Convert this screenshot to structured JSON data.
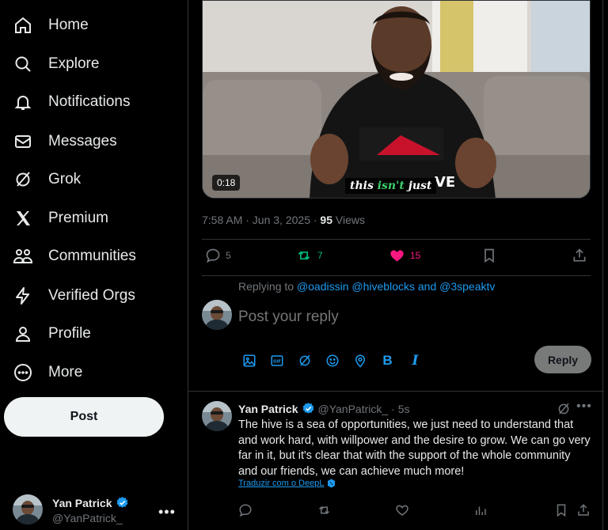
{
  "nav": {
    "home": "Home",
    "explore": "Explore",
    "notifications": "Notifications",
    "messages": "Messages",
    "grok": "Grok",
    "premium": "Premium",
    "communities": "Communities",
    "verified_orgs": "Verified Orgs",
    "profile": "Profile",
    "more": "More",
    "post_button": "Post"
  },
  "account": {
    "name": "Yan Patrick",
    "handle": "@YanPatrick_"
  },
  "video": {
    "duration": "0:18",
    "subtitle_a": "this",
    "subtitle_b": "isn't",
    "subtitle_c": "just",
    "shirt_text": "VE"
  },
  "post_meta": {
    "time": "7:58 AM · Jun 3, 2025 · ",
    "views_count": "95",
    "views_label": " Views"
  },
  "post_actions": {
    "replies": "5",
    "reposts": "7",
    "likes": "15"
  },
  "reply_box": {
    "replying_prefix": "Replying to ",
    "replying_links": "@oadissin @hiveblocks and @3speaktv",
    "placeholder": "Post your reply",
    "reply_button": "Reply",
    "bold_tool": "B",
    "italic_tool": "I",
    "gif_tool": "GIF"
  },
  "reply_tweet": {
    "name": "Yan Patrick",
    "handle": "@YanPatrick_",
    "time": "· 5s",
    "text": "The hive is a sea of opportunities, we just need to understand that and work hard, with willpower and the desire to grow. We can go very far in it, but it's clear that with the support of the whole community and our friends, we can achieve much more!",
    "translate": "Traduzir com o DeepL"
  },
  "colors": {
    "accent": "#1d9bf0",
    "repost": "#00ba7c",
    "like": "#f91880",
    "muted": "#71767b",
    "border": "#2f3336"
  }
}
